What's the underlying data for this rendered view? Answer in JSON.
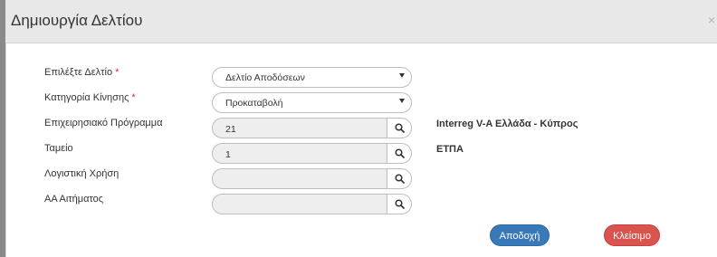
{
  "dialog": {
    "title": "Δημιουργία Δελτίου",
    "close_symbol": "×"
  },
  "form": {
    "required_marker": "*",
    "fields": [
      {
        "label": "Επιλέξτε Δελτίο",
        "required": true,
        "type": "select",
        "value": "Δελτίο Αποδόσεων"
      },
      {
        "label": "Κατηγορία Κίνησης",
        "required": true,
        "type": "select",
        "value": "Προκαταβολή"
      },
      {
        "label": "Επιχειρησιακό Πρόγραμμα",
        "required": false,
        "type": "lookup",
        "value": "21",
        "description": "Interreg V-A Ελλάδα - Κύπρος"
      },
      {
        "label": "Ταμείο",
        "required": false,
        "type": "lookup",
        "value": "1",
        "description": "ΕΤΠΑ"
      },
      {
        "label": "Λογιστική Χρήση",
        "required": false,
        "type": "lookup",
        "value": ""
      },
      {
        "label": "ΑΑ Αιτήματος",
        "required": false,
        "type": "lookup",
        "value": ""
      }
    ]
  },
  "buttons": {
    "accept_label": "Αποδοχή",
    "close_label": "Κλείσιμο"
  },
  "colors": {
    "accept": "#3a79b8",
    "close": "#d9534f",
    "required": "#e0245e",
    "header_bg": "#e8e8e8"
  },
  "icons": {
    "lookup": "search-icon",
    "select": "caret-down-icon"
  }
}
